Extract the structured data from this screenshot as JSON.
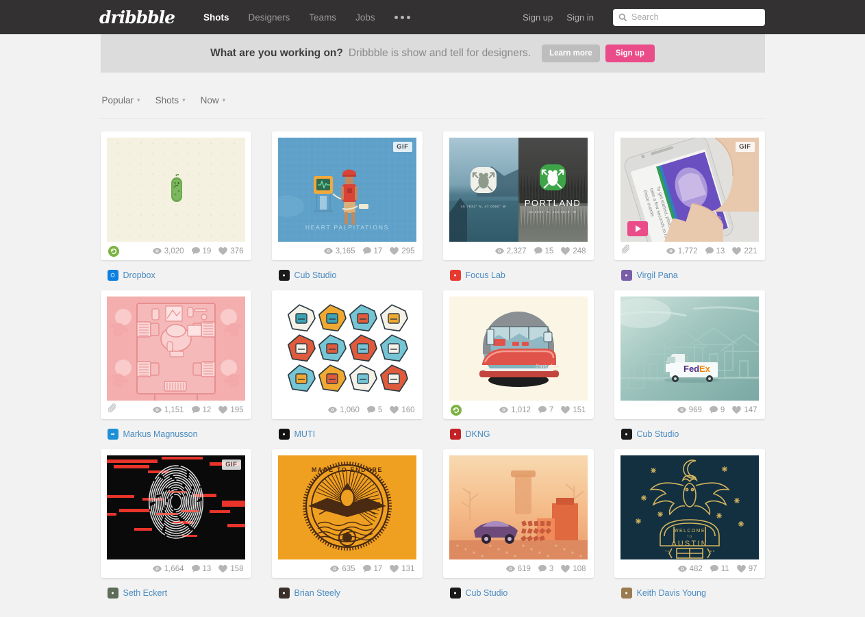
{
  "nav": {
    "logo": "dribbble",
    "links": [
      {
        "label": "Shots",
        "active": true
      },
      {
        "label": "Designers",
        "active": false
      },
      {
        "label": "Teams",
        "active": false
      },
      {
        "label": "Jobs",
        "active": false
      }
    ],
    "more_icon": "ellipsis-icon",
    "sign_up": "Sign up",
    "sign_in": "Sign in",
    "search_placeholder": "Search",
    "search_value": "",
    "bg_color": "#333132"
  },
  "banner": {
    "headline": "What are you working on?",
    "subtext": "Dribbble is show and tell for designers.",
    "learn_more": "Learn more",
    "sign_up": "Sign up",
    "accent_color": "#ea4c89"
  },
  "filters": [
    {
      "label": "Popular"
    },
    {
      "label": "Shots"
    },
    {
      "label": "Now"
    }
  ],
  "shots": [
    {
      "art": "pickle",
      "views": "3,020",
      "comments": "19",
      "likes": "376",
      "author": "Dropbox",
      "avatar_color": "#0d7fe0",
      "avatar_glyph": "⬡",
      "gif": false,
      "play": false,
      "rebound": true,
      "attachment": false
    },
    {
      "art": "palpitations",
      "title": "HEART PALPITATIONS",
      "views": "3,165",
      "comments": "17",
      "likes": "295",
      "author": "Cub Studio",
      "avatar_color": "#1a1a1a",
      "avatar_glyph": "●",
      "gif": true,
      "play": false,
      "rebound": false,
      "attachment": false
    },
    {
      "art": "portland",
      "title": "PORTLAND",
      "views": "2,327",
      "comments": "15",
      "likes": "248",
      "author": "Focus Lab",
      "avatar_color": "#e8392f",
      "avatar_glyph": "●",
      "gif": false,
      "play": false,
      "rebound": false,
      "attachment": false
    },
    {
      "art": "phone",
      "views": "1,772",
      "comments": "13",
      "likes": "221",
      "author": "Virgil Pana",
      "avatar_color": "#7a5ea8",
      "avatar_glyph": "●",
      "gif": true,
      "play": true,
      "rebound": false,
      "attachment": true
    },
    {
      "art": "pinkdesk",
      "views": "1,151",
      "comments": "12",
      "likes": "195",
      "author": "Markus Magnusson",
      "avatar_color": "#1e8fd5",
      "avatar_glyph": "⇒",
      "gif": false,
      "play": false,
      "rebound": false,
      "attachment": true
    },
    {
      "art": "badges",
      "views": "1,060",
      "comments": "5",
      "likes": "160",
      "author": "MUTI",
      "avatar_color": "#111111",
      "avatar_glyph": "●",
      "gif": false,
      "play": false,
      "rebound": false,
      "attachment": false
    },
    {
      "art": "stapler",
      "views": "1,012",
      "comments": "7",
      "likes": "151",
      "author": "DKNG",
      "avatar_color": "#c42127",
      "avatar_glyph": "●",
      "gif": false,
      "play": false,
      "rebound": true,
      "attachment": false
    },
    {
      "art": "fedex",
      "views": "969",
      "comments": "9",
      "likes": "147",
      "author": "Cub Studio",
      "avatar_color": "#1a1a1a",
      "avatar_glyph": "●",
      "gif": false,
      "play": false,
      "rebound": false,
      "attachment": false
    },
    {
      "art": "fingerprint",
      "views": "1,664",
      "comments": "13",
      "likes": "158",
      "author": "Seth Eckert",
      "avatar_color": "#5d6b59",
      "avatar_glyph": "●",
      "gif": true,
      "play": false,
      "rebound": false,
      "attachment": false
    },
    {
      "art": "seal",
      "title": "MADE TO ENDURE",
      "views": "635",
      "comments": "17",
      "likes": "131",
      "author": "Brian Steely",
      "avatar_color": "#3b2f2a",
      "avatar_glyph": "●",
      "gif": false,
      "play": false,
      "rebound": false,
      "attachment": false
    },
    {
      "art": "sunset",
      "views": "619",
      "comments": "3",
      "likes": "108",
      "author": "Cub Studio",
      "avatar_color": "#1a1a1a",
      "avatar_glyph": "●",
      "gif": false,
      "play": false,
      "rebound": false,
      "attachment": false
    },
    {
      "art": "austin",
      "title": "WELCOME TO AUSTIN",
      "views": "482",
      "comments": "11",
      "likes": "97",
      "author": "Keith Davis Young",
      "avatar_color": "#9a7b4f",
      "avatar_glyph": "●",
      "gif": false,
      "play": false,
      "rebound": false,
      "attachment": false
    }
  ],
  "icons": {
    "views": "eye-icon",
    "comments": "comment-icon",
    "likes": "heart-icon",
    "attachment": "paperclip-icon",
    "rebound": "rebound-icon",
    "gif": "GIF",
    "play": "play-icon",
    "search": "search-icon"
  }
}
